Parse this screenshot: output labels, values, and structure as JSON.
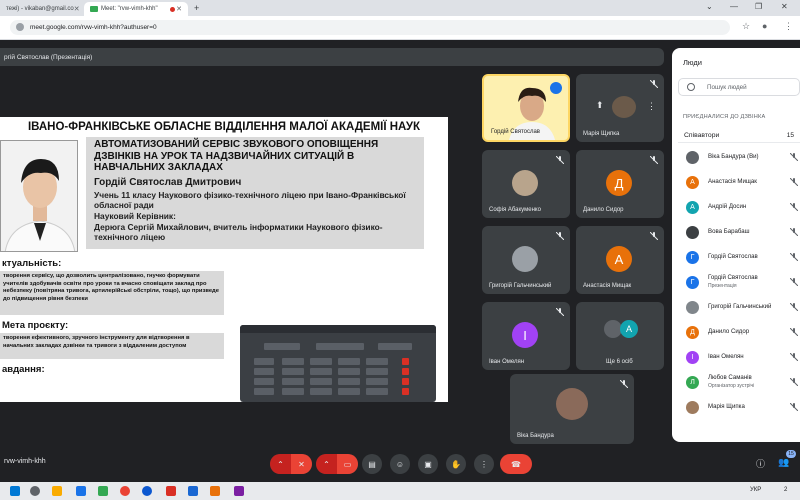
{
  "browser": {
    "tabs": [
      {
        "label": "тежі) - vikaban@gmail.co",
        "active": false
      },
      {
        "label": "Meet: \"rvw-vimh-khh\"",
        "active": true
      }
    ],
    "url": "meet.google.com/rvw-vimh-khh?authuser=0"
  },
  "presentation": {
    "presenter_label": "ргій Святослав (Презентація)",
    "slide": {
      "title": "ІВАНО-ФРАНКІВСЬКЕ ОБЛАСНЕ ВІДДІЛЕННЯ МАЛОЇ АКАДЕМІЇ НАУК",
      "heading": "АВТОМАТИЗОВАНИЙ СЕРВІС ЗВУКОВОГО ОПОВІЩЕННЯ ДЗВІНКІВ НА УРОК ТА НАДЗВИЧАЙНИХ СИТУАЦІЙ В НАВЧАЛЬНИХ ЗАКЛАДАХ",
      "author": "Гордій Святослав Дмитрович",
      "school": "Учень 11 класу Наукового фізико-технічного ліцею при Івано-Франківської обласної ради",
      "supervisor_label": "Науковий Керівник:",
      "supervisor": "Дерюга Сергій Михайлович, вчитель інформатики Наукового фізико-технічного ліцею",
      "sec_relevance": "ктуальність:",
      "relevance_text": "творення сервісу, що дозволить централізовано, гнучко формувати учителів здобувачів освіти про уроки та вчасно сповіщати заклад про небезпеку (повітряна тривога, артилерійські обстріли, тощо), що призведе до підвищення рівня безпеки",
      "sec_goal": "Мета проєкту:",
      "goal_text": "творення ефективного, зручного інструменту для відтворення в начальних закладах дзвінки та тривоги з віддаленим доступом",
      "sec_tasks": "авдання:"
    }
  },
  "tiles": [
    {
      "name": "Гордій Святослав",
      "type": "video",
      "speaking": true
    },
    {
      "name": "Марія Щипка",
      "type": "video"
    },
    {
      "name": "Софія Абакуменко",
      "type": "photo"
    },
    {
      "name": "Данило Сидор",
      "type": "letter",
      "letter": "Д",
      "color": "#e8710a"
    },
    {
      "name": "Григорій Гальчинський",
      "type": "photo"
    },
    {
      "name": "Анастасія Мищак",
      "type": "letter",
      "letter": "А",
      "color": "#e8710a"
    },
    {
      "name": "Іван Омелян",
      "type": "letter",
      "letter": "І",
      "color": "#a142f4"
    },
    {
      "name": "Ще 6 осіб",
      "type": "group",
      "letter": "А",
      "color": "#12a4af"
    },
    {
      "name": "Віка Бандура",
      "type": "photo"
    }
  ],
  "people_panel": {
    "title": "Люди",
    "search_placeholder": "Пошук людей",
    "joined_label": "ПРИЄДНАЛИСЯ ДО ДЗВІНКА",
    "section_label": "Співавтори",
    "section_count": "15",
    "people": [
      {
        "name": "Віка Бандура (Ви)",
        "sub": "",
        "letter": "",
        "color": "#5f6368"
      },
      {
        "name": "Анастасія Мищак",
        "sub": "",
        "letter": "А",
        "color": "#e8710a"
      },
      {
        "name": "Андрій Досин",
        "sub": "",
        "letter": "А",
        "color": "#12a4af"
      },
      {
        "name": "Вова Барабаш",
        "sub": "",
        "letter": "",
        "color": "#3c4043"
      },
      {
        "name": "Гордій Святослав",
        "sub": "",
        "letter": "Г",
        "color": "#1a73e8"
      },
      {
        "name": "Гордій Святослав",
        "sub": "Презентація",
        "letter": "Г",
        "color": "#1a73e8"
      },
      {
        "name": "Григорій Гальчинський",
        "sub": "",
        "letter": "",
        "color": "#80868b"
      },
      {
        "name": "Данило Сидор",
        "sub": "",
        "letter": "Д",
        "color": "#e8710a"
      },
      {
        "name": "Іван Омелян",
        "sub": "",
        "letter": "І",
        "color": "#a142f4"
      },
      {
        "name": "Любов Саманів",
        "sub": "Організатор зустрічі",
        "letter": "Л",
        "color": "#34a853"
      },
      {
        "name": "Марія Щипка",
        "sub": "",
        "letter": "",
        "color": "#9e7b5e"
      }
    ]
  },
  "bottom": {
    "meet_code": "rvw-vimh-khh",
    "participants_badge": "15"
  },
  "taskbar": {
    "lang": "УКР",
    "time": "2"
  },
  "colors": {
    "speaking_border": "#fdd663",
    "end_call": "#ea4335"
  }
}
